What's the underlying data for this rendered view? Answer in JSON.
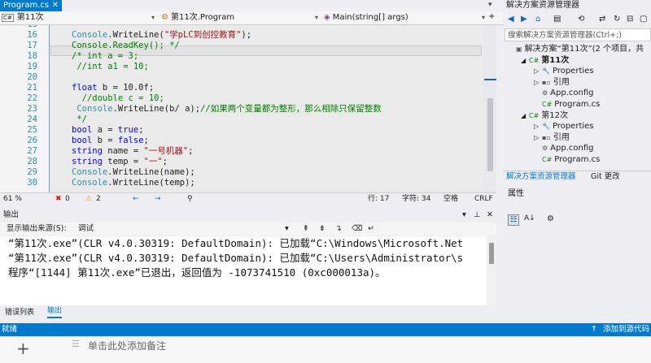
{
  "doc_tab": {
    "label": "Program.cs",
    "close": "✕"
  },
  "nav": {
    "project": "第11次",
    "class": "第11次.Program",
    "member": "Main(string[] args)",
    "cs_badge": "C#"
  },
  "code_lines": [
    {
      "num": "15",
      "text": ""
    },
    {
      "num": "16",
      "text": "Console.WriteLine(\"学pLC到创控教育\");"
    },
    {
      "num": "17",
      "text": "Console.ReadKey(); */"
    },
    {
      "num": "18",
      "text": "/* int a = 3;"
    },
    {
      "num": "19",
      "text": " //int a1 = 10;"
    },
    {
      "num": "20",
      "text": ""
    },
    {
      "num": "21",
      "text": "float b = 10.0f;"
    },
    {
      "num": "22",
      "text": "  //double c = 10;"
    },
    {
      "num": "23",
      "text": " Console.WriteLine(b/ a);//如果两个变量都为整形，那么相除只保留整数"
    },
    {
      "num": "24",
      "text": " */"
    },
    {
      "num": "25",
      "text": "bool a = true;"
    },
    {
      "num": "26",
      "text": "bool b = false;"
    },
    {
      "num": "27",
      "text": "string name = \"一号机器\";"
    },
    {
      "num": "28",
      "text": "string temp = \"一\";"
    },
    {
      "num": "29",
      "text": "Console.WriteLine(name);"
    },
    {
      "num": "30",
      "text": "Console.WriteLine(temp);"
    }
  ],
  "editor_status": {
    "zoom": "61 %",
    "errors": "0",
    "warnings": "2",
    "line": "行: 17",
    "char": "字符: 34",
    "spaces": "空格",
    "eol": "CRLF"
  },
  "output": {
    "title": "输出",
    "source_label": "显示输出来源(S):",
    "source_value": "调试",
    "lines": [
      "“第11次.exe”(CLR v4.0.30319: DefaultDomain): 已加载“C:\\Windows\\Microsoft.Net",
      "“第11次.exe”(CLR v4.0.30319: DefaultDomain): 已加载“C:\\Users\\Administrator\\s",
      "程序“[1144] 第11次.exe”已退出，返回值为 -1073741510 (0xc000013a)。"
    ]
  },
  "bottom_tabs": [
    "错误列表",
    "输出"
  ],
  "solution": {
    "title": "解决方案资源管理器",
    "search_placeholder": "搜索解决方案资源管理器(Ctrl+;)",
    "items": [
      {
        "label": "解决方案“第11次”(2 个项目，共",
        "level": 0,
        "icon": "solution-icon"
      },
      {
        "label": "第11次",
        "level": 1,
        "icon": "csproj-icon",
        "bold": true
      },
      {
        "label": "Properties",
        "level": 2,
        "icon": "wrench-icon"
      },
      {
        "label": "引用",
        "level": 2,
        "icon": "references-icon"
      },
      {
        "label": "App.config",
        "level": 2,
        "icon": "config-icon"
      },
      {
        "label": "Program.cs",
        "level": 2,
        "icon": "csfile-icon"
      },
      {
        "label": "第12次",
        "level": 1,
        "icon": "csproj-icon"
      },
      {
        "label": "Properties",
        "level": 2,
        "icon": "wrench-icon"
      },
      {
        "label": "引用",
        "level": 2,
        "icon": "references-icon"
      },
      {
        "label": "App.config",
        "level": 2,
        "icon": "config-icon"
      },
      {
        "label": "Program.cs",
        "level": 2,
        "icon": "csfile-icon"
      }
    ],
    "tabs": [
      "解决方案资源管理器",
      "Git 更改"
    ]
  },
  "properties": {
    "title": "属性"
  },
  "status_bar": {
    "left": "就绪",
    "right": "添加到源代码"
  },
  "taskbar": {
    "text": "单击此处添加备注"
  },
  "colors": {
    "accent": "#007acc",
    "keyword": "#0000ff",
    "string": "#a31515",
    "comment": "#008000",
    "type": "#2b91af"
  }
}
